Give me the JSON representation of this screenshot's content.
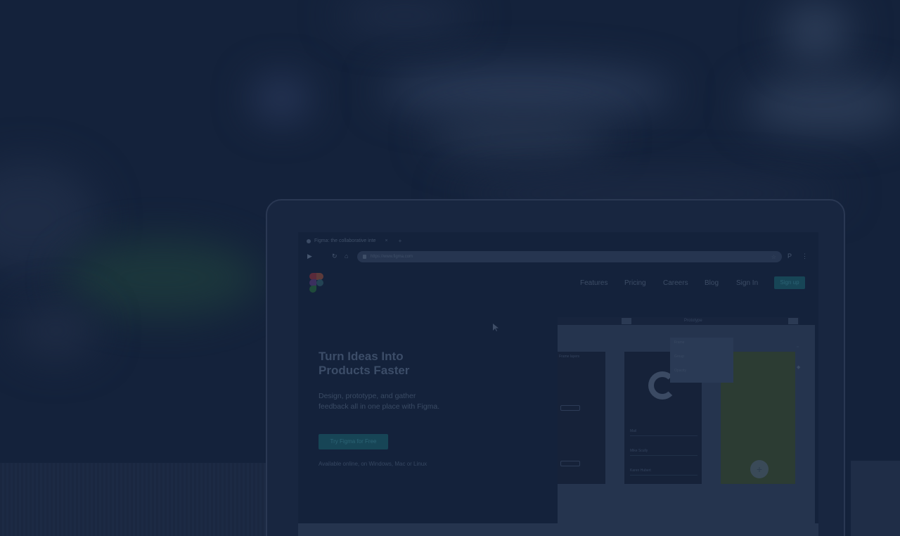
{
  "browser": {
    "tab_title": "Figma: the collaborative inte",
    "tab_close": "×",
    "tab_new": "+",
    "back": "▶",
    "reload": "↻",
    "home": "⌂",
    "address": "https://www.figma.com",
    "menu": "⋮",
    "ext": "P"
  },
  "site": {
    "nav": [
      "Features",
      "Pricing",
      "Careers",
      "Blog",
      "Sign In"
    ],
    "signup_label": "Sign up",
    "hero_title": "Turn Ideas Into\nProducts Faster",
    "hero_subtitle": "Design, prototype, and gather\nfeedback all in one place with Figma.",
    "cta_label": "Try Figma for Free",
    "availability": "Available online, on Windows, Mac or Linux"
  },
  "editor": {
    "topbar_label": "Prototype",
    "layers_label": "Frame layers",
    "list_rows": [
      "Mail",
      "Mike Scully",
      "Karen Hubert"
    ],
    "popover_rows": [
      "Frame",
      "Group",
      "Opacity"
    ]
  },
  "colors": {
    "overlay_navy": "#14223b",
    "brand_teal": "#174556",
    "figma_red": "#5a2a3a",
    "figma_purple": "#3b2f5e",
    "figma_green": "#1f4a3a"
  },
  "icons": [
    "figma-logo-icon",
    "back-icon",
    "reload-icon",
    "home-icon",
    "lock-icon",
    "star-icon",
    "menu-icon",
    "cursor-icon",
    "add-icon"
  ]
}
